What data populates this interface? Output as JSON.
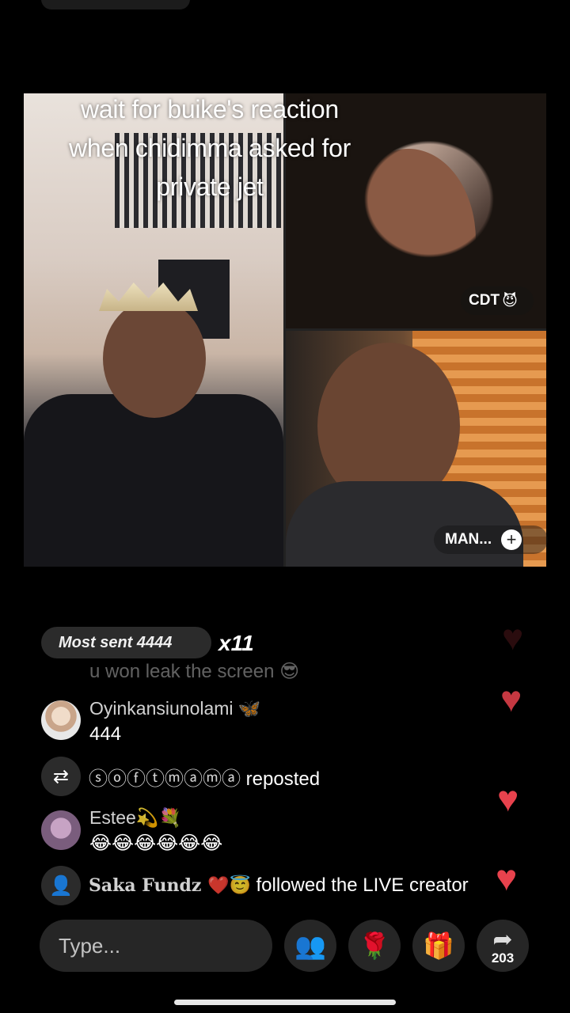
{
  "video": {
    "caption_lines": [
      "wait for buike's reaction",
      "when chidimma asked for",
      "private jet"
    ],
    "tags": {
      "top_right": {
        "label": "CDT",
        "emoji": "😈"
      },
      "bottom_right": {
        "label": "MAN..."
      }
    }
  },
  "gift_bar": {
    "label": "Most sent 4444",
    "multiplier": "x11"
  },
  "chat": {
    "faded_comment": "u won leak the screen 😎",
    "comments": [
      {
        "name": "Oyinkansiunolami 🦋",
        "text": "444"
      },
      {
        "name": "Estee💫💐",
        "text": "😂😂😂😂😂😂"
      }
    ],
    "repost": {
      "user": "ⓢⓞⓕⓣⓜⓐⓜⓐ",
      "action": "reposted"
    },
    "follow": {
      "user": "Saka Fundz ❤️😇",
      "action": "followed the LIVE creator"
    }
  },
  "bottom": {
    "input_placeholder": "Type...",
    "share_count": "203"
  },
  "colors": {
    "heart": "#e8424d",
    "background": "#000000"
  },
  "icons": [
    "people-icon",
    "rose-icon",
    "gift-icon",
    "share-icon",
    "repost-icon",
    "follow-icon",
    "heart-icon",
    "plus-icon"
  ]
}
